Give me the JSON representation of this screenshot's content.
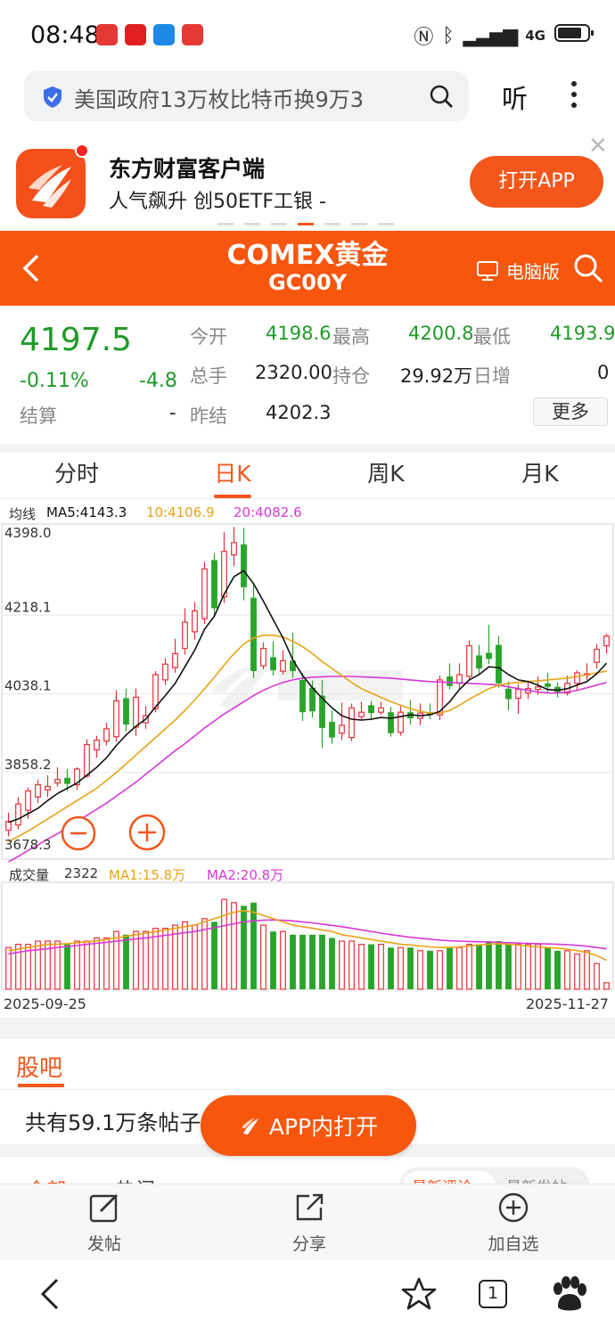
{
  "status_bar": {
    "time": "08:48",
    "network": "4G"
  },
  "search": {
    "query": "美国政府13万枚比特币换9万3",
    "listen_label": "听"
  },
  "promo": {
    "title": "东方财富客户端",
    "subtitle": "人气飙升  创50ETF工银 -",
    "button": "打开APP",
    "close": "✕"
  },
  "header": {
    "title": "COMEX黄金",
    "code": "GC00Y",
    "pc_label": "电脑版"
  },
  "quote": {
    "price": "4197.5",
    "change_pct": "-0.11%",
    "change": "-4.8",
    "settle_label": "结算",
    "settle_value": "-",
    "open_label": "今开",
    "open_value": "4198.6",
    "high_label": "最高",
    "high_value": "4200.8",
    "low_label": "最低",
    "low_value": "4193.9",
    "volume_label": "总手",
    "volume_value": "2320.00",
    "position_label": "持仓",
    "position_value": "29.92万",
    "daily_add_label": "日增",
    "daily_add_value": "0",
    "prev_settle_label": "昨结",
    "prev_settle_value": "4202.3",
    "more_label": "更多"
  },
  "tabs": [
    {
      "label": "分时",
      "active": false
    },
    {
      "label": "日K",
      "active": true
    },
    {
      "label": "周K",
      "active": false
    },
    {
      "label": "月K",
      "active": false
    }
  ],
  "chart_legend": {
    "ma_prefix": "均线",
    "ma5": "MA5:4143.3",
    "ma10": "10:4106.9",
    "ma20": "20:4082.6",
    "vol_prefix": "成交量",
    "vol_value": "2322",
    "vol_ma1": "MA1:15.8万",
    "vol_ma2": "MA2:20.8万"
  },
  "chart_data": {
    "type": "candlestick",
    "y_ticks": [
      "4398.0",
      "4218.1",
      "4038.1",
      "3858.2",
      "3678.3"
    ],
    "ylim": [
      3678.3,
      4398.0
    ],
    "x_start_label": "2025-09-25",
    "x_end_label": "2025-11-27",
    "colors": {
      "up": "#e8303a",
      "down": "#2aa42a",
      "ma5": "#111111",
      "ma10": "#e8a317",
      "ma20": "#d63ad6"
    },
    "candles": [
      {
        "o": 3726,
        "c": 3746,
        "h": 3766,
        "l": 3712,
        "d": 0
      },
      {
        "o": 3738,
        "c": 3786,
        "h": 3802,
        "l": 3728,
        "d": 0
      },
      {
        "o": 3772,
        "c": 3816,
        "h": 3824,
        "l": 3752,
        "d": 0
      },
      {
        "o": 3802,
        "c": 3830,
        "h": 3842,
        "l": 3788,
        "d": 0
      },
      {
        "o": 3818,
        "c": 3826,
        "h": 3852,
        "l": 3802,
        "d": 0
      },
      {
        "o": 3834,
        "c": 3842,
        "h": 3870,
        "l": 3826,
        "d": 0
      },
      {
        "o": 3846,
        "c": 3832,
        "h": 3866,
        "l": 3816,
        "d": 1
      },
      {
        "o": 3830,
        "c": 3866,
        "h": 3870,
        "l": 3818,
        "d": 0
      },
      {
        "o": 3850,
        "c": 3922,
        "h": 3934,
        "l": 3846,
        "d": 0
      },
      {
        "o": 3910,
        "c": 3932,
        "h": 3942,
        "l": 3892,
        "d": 0
      },
      {
        "o": 3930,
        "c": 3958,
        "h": 3972,
        "l": 3920,
        "d": 0
      },
      {
        "o": 3940,
        "c": 4022,
        "h": 4046,
        "l": 3928,
        "d": 0
      },
      {
        "o": 4028,
        "c": 3968,
        "h": 4050,
        "l": 3952,
        "d": 1
      },
      {
        "o": 3962,
        "c": 4030,
        "h": 4050,
        "l": 3942,
        "d": 0
      },
      {
        "o": 3972,
        "c": 3988,
        "h": 4010,
        "l": 3958,
        "d": 0
      },
      {
        "o": 4004,
        "c": 4082,
        "h": 4090,
        "l": 3996,
        "d": 0
      },
      {
        "o": 4070,
        "c": 4106,
        "h": 4120,
        "l": 4058,
        "d": 0
      },
      {
        "o": 4098,
        "c": 4130,
        "h": 4164,
        "l": 4086,
        "d": 0
      },
      {
        "o": 4142,
        "c": 4202,
        "h": 4234,
        "l": 4128,
        "d": 0
      },
      {
        "o": 4180,
        "c": 4228,
        "h": 4248,
        "l": 4162,
        "d": 0
      },
      {
        "o": 4210,
        "c": 4324,
        "h": 4340,
        "l": 4198,
        "d": 0
      },
      {
        "o": 4344,
        "c": 4234,
        "h": 4360,
        "l": 4214,
        "d": 1
      },
      {
        "o": 4260,
        "c": 4364,
        "h": 4408,
        "l": 4246,
        "d": 0
      },
      {
        "o": 4356,
        "c": 4384,
        "h": 4420,
        "l": 4330,
        "d": 0
      },
      {
        "o": 4380,
        "c": 4282,
        "h": 4418,
        "l": 4252,
        "d": 1
      },
      {
        "o": 4258,
        "c": 4090,
        "h": 4292,
        "l": 4074,
        "d": 1
      },
      {
        "o": 4102,
        "c": 4142,
        "h": 4156,
        "l": 4094,
        "d": 0
      },
      {
        "o": 4122,
        "c": 4092,
        "h": 4158,
        "l": 4080,
        "d": 1
      },
      {
        "o": 4090,
        "c": 4114,
        "h": 4138,
        "l": 4082,
        "d": 0
      },
      {
        "o": 4114,
        "c": 4090,
        "h": 4178,
        "l": 4074,
        "d": 1
      },
      {
        "o": 4070,
        "c": 3996,
        "h": 4086,
        "l": 3976,
        "d": 1
      },
      {
        "o": 4052,
        "c": 3998,
        "h": 4068,
        "l": 3984,
        "d": 1
      },
      {
        "o": 4034,
        "c": 3960,
        "h": 4070,
        "l": 3914,
        "d": 1
      },
      {
        "o": 3974,
        "c": 3938,
        "h": 4000,
        "l": 3924,
        "d": 1
      },
      {
        "o": 3948,
        "c": 3966,
        "h": 4018,
        "l": 3932,
        "d": 0
      },
      {
        "o": 3938,
        "c": 4006,
        "h": 4016,
        "l": 3930,
        "d": 0
      },
      {
        "o": 3986,
        "c": 3996,
        "h": 4020,
        "l": 3980,
        "d": 0
      },
      {
        "o": 4012,
        "c": 3994,
        "h": 4022,
        "l": 3978,
        "d": 1
      },
      {
        "o": 3996,
        "c": 4006,
        "h": 4020,
        "l": 3990,
        "d": 0
      },
      {
        "o": 3996,
        "c": 3948,
        "h": 4008,
        "l": 3940,
        "d": 1
      },
      {
        "o": 3950,
        "c": 3996,
        "h": 4010,
        "l": 3942,
        "d": 0
      },
      {
        "o": 3996,
        "c": 3982,
        "h": 4024,
        "l": 3968,
        "d": 1
      },
      {
        "o": 3982,
        "c": 3994,
        "h": 4016,
        "l": 3966,
        "d": 0
      },
      {
        "o": 3996,
        "c": 3990,
        "h": 4016,
        "l": 3980,
        "d": 1
      },
      {
        "o": 3990,
        "c": 4070,
        "h": 4080,
        "l": 3978,
        "d": 0
      },
      {
        "o": 4078,
        "c": 4056,
        "h": 4108,
        "l": 4048,
        "d": 1
      },
      {
        "o": 4062,
        "c": 4082,
        "h": 4108,
        "l": 4050,
        "d": 0
      },
      {
        "o": 4078,
        "c": 4148,
        "h": 4160,
        "l": 4068,
        "d": 0
      },
      {
        "o": 4126,
        "c": 4096,
        "h": 4150,
        "l": 4082,
        "d": 1
      },
      {
        "o": 4132,
        "c": 4118,
        "h": 4196,
        "l": 4106,
        "d": 1
      },
      {
        "o": 4150,
        "c": 4062,
        "h": 4170,
        "l": 4052,
        "d": 1
      },
      {
        "o": 4050,
        "c": 4026,
        "h": 4066,
        "l": 4000,
        "d": 1
      },
      {
        "o": 4028,
        "c": 4048,
        "h": 4060,
        "l": 3992,
        "d": 0
      },
      {
        "o": 4040,
        "c": 4050,
        "h": 4068,
        "l": 4026,
        "d": 0
      },
      {
        "o": 4048,
        "c": 4054,
        "h": 4078,
        "l": 4036,
        "d": 0
      },
      {
        "o": 4062,
        "c": 4054,
        "h": 4086,
        "l": 4040,
        "d": 1
      },
      {
        "o": 4054,
        "c": 4042,
        "h": 4064,
        "l": 4030,
        "d": 1
      },
      {
        "o": 4040,
        "c": 4062,
        "h": 4080,
        "l": 4034,
        "d": 0
      },
      {
        "o": 4062,
        "c": 4086,
        "h": 4092,
        "l": 4046,
        "d": 0
      },
      {
        "o": 4082,
        "c": 4084,
        "h": 4108,
        "l": 4070,
        "d": 0
      },
      {
        "o": 4110,
        "c": 4140,
        "h": 4152,
        "l": 4096,
        "d": 0
      },
      {
        "o": 4148,
        "c": 4170,
        "h": 4176,
        "l": 4130,
        "d": 0
      }
    ],
    "ma5": [
      3744,
      3752,
      3764,
      3776,
      3794,
      3810,
      3822,
      3834,
      3852,
      3870,
      3892,
      3920,
      3944,
      3964,
      3980,
      4008,
      4034,
      4062,
      4100,
      4138,
      4186,
      4216,
      4266,
      4306,
      4320,
      4290,
      4250,
      4208,
      4166,
      4116,
      4080,
      4052,
      4028,
      4006,
      3988,
      3980,
      3978,
      3980,
      3984,
      3982,
      3986,
      3990,
      3988,
      3990,
      3998,
      4020,
      4048,
      4070,
      4082,
      4100,
      4098,
      4082,
      4070,
      4066,
      4058,
      4048,
      4046,
      4050,
      4058,
      4066,
      4084,
      4108
    ],
    "ma10": [
      3700,
      3712,
      3724,
      3738,
      3752,
      3766,
      3780,
      3794,
      3808,
      3822,
      3840,
      3858,
      3878,
      3898,
      3918,
      3938,
      3958,
      3978,
      4000,
      4024,
      4050,
      4076,
      4104,
      4130,
      4152,
      4166,
      4172,
      4172,
      4168,
      4158,
      4146,
      4130,
      4112,
      4096,
      4080,
      4064,
      4050,
      4040,
      4030,
      4020,
      4012,
      4004,
      3998,
      3994,
      3994,
      4000,
      4012,
      4026,
      4038,
      4050,
      4058,
      4062,
      4064,
      4066,
      4068,
      4070,
      4072,
      4074,
      4078,
      4082,
      4086,
      4090
    ],
    "ma20": [
      3654,
      3666,
      3680,
      3692,
      3706,
      3718,
      3732,
      3746,
      3760,
      3774,
      3788,
      3804,
      3820,
      3836,
      3854,
      3872,
      3890,
      3908,
      3924,
      3942,
      3960,
      3976,
      3992,
      4006,
      4020,
      4034,
      4046,
      4056,
      4064,
      4070,
      4074,
      4076,
      4077,
      4078,
      4078,
      4078,
      4077,
      4076,
      4075,
      4074,
      4072,
      4070,
      4068,
      4066,
      4065,
      4064,
      4063,
      4062,
      4061,
      4060,
      4058,
      4054,
      4050,
      4046,
      4042,
      4040,
      4040,
      4042,
      4046,
      4052,
      4058,
      4064
    ],
    "volume": [
      13,
      14,
      14,
      15,
      15,
      15,
      14,
      15,
      15,
      16,
      16,
      18,
      17,
      18,
      18,
      19,
      19,
      20,
      21,
      20,
      22,
      21,
      28,
      27,
      26,
      27,
      20,
      18,
      18,
      17,
      17,
      17,
      17,
      16,
      15,
      15,
      14,
      14,
      14,
      13,
      13,
      13,
      12,
      12,
      12,
      13,
      13,
      14,
      14,
      15,
      15,
      14,
      14,
      14,
      14,
      13,
      12,
      12,
      11,
      12,
      8,
      2
    ],
    "volume_ma1": [
      12,
      12.5,
      13,
      13.5,
      14,
      14,
      14.2,
      14.5,
      14.8,
      15,
      15.5,
      16,
      16.5,
      17,
      17.5,
      18,
      18.5,
      19,
      19.5,
      20,
      21,
      22,
      23,
      24,
      24.5,
      24,
      23,
      22,
      21,
      20,
      19.5,
      19,
      18.5,
      18,
      17,
      16.5,
      16,
      15.5,
      15,
      14.5,
      14,
      13.8,
      13.5,
      13.2,
      13,
      13,
      13.2,
      13.5,
      13.8,
      14,
      14.2,
      14,
      13.8,
      13.5,
      13.2,
      13,
      12.8,
      12.5,
      12,
      11.5,
      10.5,
      9
    ],
    "volume_ma2": [
      11,
      11.5,
      12,
      12.3,
      12.6,
      13,
      13.3,
      13.6,
      14,
      14.3,
      14.6,
      15,
      15.3,
      15.7,
      16,
      16.4,
      16.8,
      17.2,
      17.6,
      18,
      18.6,
      19.2,
      19.8,
      20.4,
      21,
      21.3,
      21.5,
      21.6,
      21.5,
      21.3,
      21,
      20.7,
      20.3,
      19.9,
      19.5,
      19,
      18.5,
      18,
      17.5,
      17,
      16.6,
      16.2,
      15.9,
      15.6,
      15.3,
      15.1,
      15,
      14.9,
      14.8,
      14.7,
      14.6,
      14.5,
      14.4,
      14.3,
      14.2,
      14.1,
      14,
      13.9,
      13.7,
      13.4,
      13,
      12.6
    ]
  },
  "guba": {
    "title": "股吧",
    "posts_count": "共有59.1万条帖子",
    "open_in_app": "APP内打开",
    "peek_left": "全部",
    "peek_mid": "热门",
    "peek_right1": "最新评论",
    "peek_right2": "最新发帖"
  },
  "toolbar": {
    "post": "发帖",
    "share": "分享",
    "add_watch": "加自选"
  },
  "navbar": {
    "tabs_count": "1"
  }
}
